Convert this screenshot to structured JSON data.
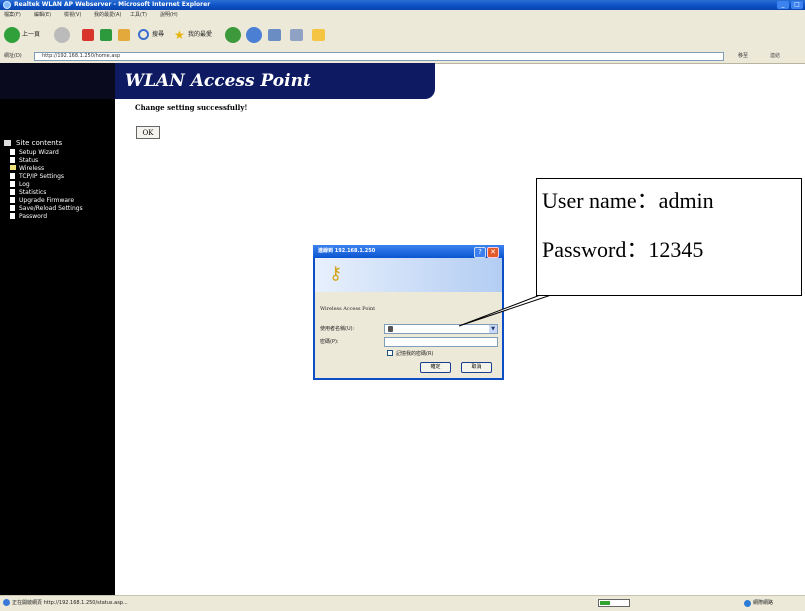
{
  "window": {
    "title": "Realtek WLAN AP Webserver - Microsoft Internet Explorer",
    "buttons": [
      "_",
      "□"
    ]
  },
  "menu": [
    "檔案(F)",
    "編輯(E)",
    "檢視(V)",
    "我的最愛(A)",
    "工具(T)",
    "說明(H)"
  ],
  "toolbar": {
    "back": "上一頁",
    "search": "搜尋",
    "favorites": "我的最愛"
  },
  "address": {
    "label": "網址(D)",
    "url": "http://192.168.1.250/home.asp",
    "go": "移至",
    "links": "連結"
  },
  "page": {
    "banner_title": "WLAN Access Point",
    "message": "Change setting successfully!",
    "ok_button": "OK"
  },
  "sidebar": {
    "header": "Site contents",
    "items": [
      "Setup Wizard",
      "Status",
      "Wireless",
      "TCP/IP Settings",
      "Log",
      "Statistics",
      "Upgrade Firmware",
      "Save/Reload Settings",
      "Password"
    ]
  },
  "dialog": {
    "title": "連線到 192.168.1.250",
    "header": "Wireless Access Point",
    "user_label": "使用者名稱(U):",
    "user_value": "",
    "password_label": "密碼(P):",
    "remember_label": "記憶我的密碼(R)",
    "ok": "確定",
    "cancel": "取消"
  },
  "callout": {
    "line1": "User name：admin",
    "line2": "Password：12345"
  },
  "status": {
    "text": "正在開啟網頁 http://192.168.1.250/status.asp...",
    "zone": "網際網路",
    "progress": 0.35
  }
}
